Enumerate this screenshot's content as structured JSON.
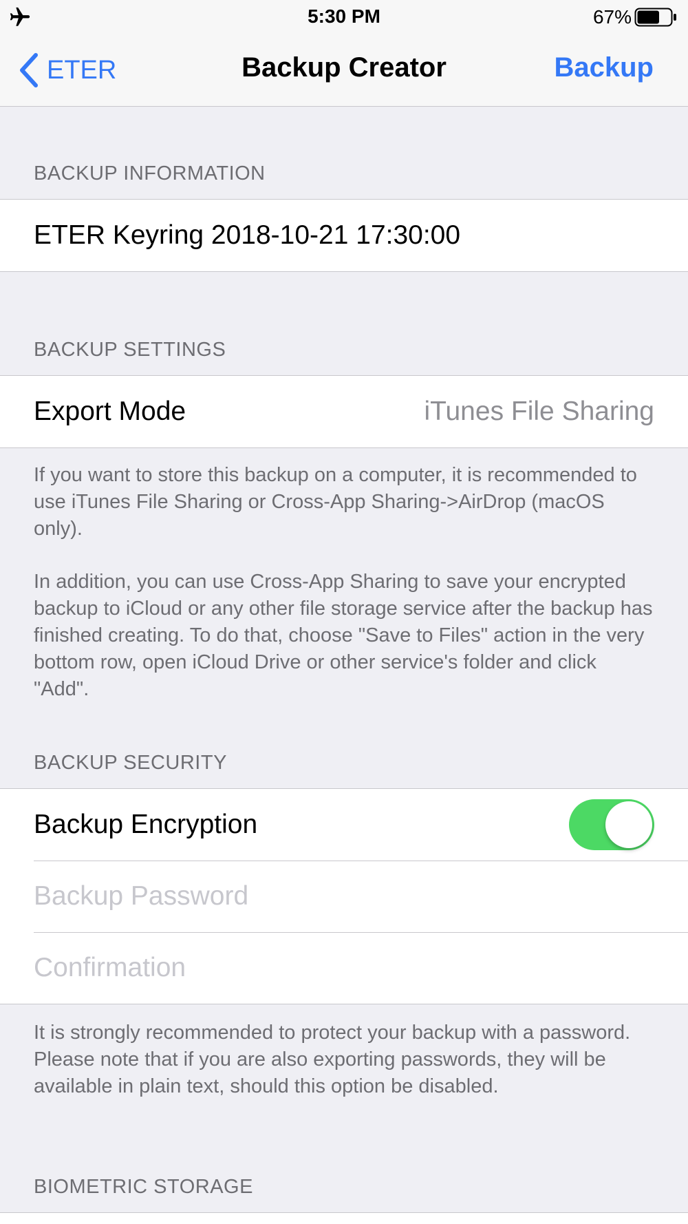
{
  "status_bar": {
    "time": "5:30 PM",
    "battery_percent": "67%",
    "battery_level": 0.67,
    "icons": [
      "airplane-icon",
      "battery-icon"
    ]
  },
  "nav": {
    "back_label": "ETER",
    "title": "Backup Creator",
    "action_label": "Backup",
    "accent_color": "#3478f6"
  },
  "sections": {
    "info": {
      "header": "BACKUP INFORMATION",
      "backup_name": "ETER Keyring 2018-10-21 17:30:00"
    },
    "settings": {
      "header": "BACKUP SETTINGS",
      "export_mode_label": "Export Mode",
      "export_mode_value": "iTunes File Sharing",
      "footer_p1": "If you want to store this backup on a computer, it is recommended to use iTunes File Sharing or Cross-App Sharing->AirDrop (macOS only).",
      "footer_p2": "In addition, you can use Cross-App Sharing to save your encrypted backup to iCloud or any other file storage service after the backup has finished creating. To do that, choose \"Save to Files\" action in the very bottom row, open iCloud Drive or other service's folder and click \"Add\"."
    },
    "security": {
      "header": "BACKUP SECURITY",
      "encryption_label": "Backup Encryption",
      "encryption_enabled": true,
      "password_placeholder": "Backup Password",
      "confirmation_placeholder": "Confirmation",
      "footer": "It is strongly recommended to protect your backup with a password. Please note that if you are also exporting passwords, they will be available in plain text, should this option be disabled.",
      "switch_color": "#4cd964"
    },
    "biometric": {
      "header": "BIOMETRIC STORAGE"
    }
  }
}
